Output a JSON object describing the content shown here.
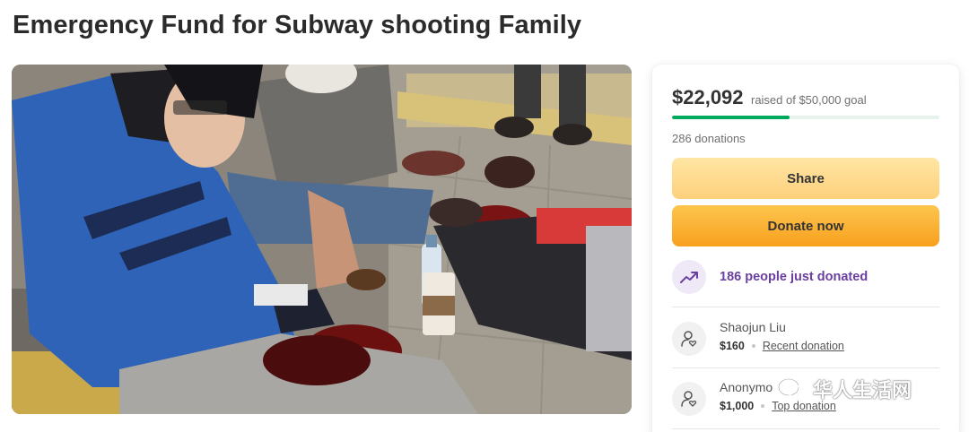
{
  "page": {
    "title": "Emergency Fund for Subway shooting Family"
  },
  "fundraiser": {
    "raised": "$22,092",
    "goal_text": "raised of $50,000 goal",
    "progress_fraction": 0.44,
    "donation_count": "286 donations",
    "share_label": "Share",
    "donate_label": "Donate now",
    "just_donated": "186 people just donated",
    "accent_color": "#02a95c",
    "trend_color": "#6b3fa0"
  },
  "donors": [
    {
      "name": "Shaojun Liu",
      "amount": "$160",
      "tag": "Recent donation",
      "icon": "donor-heart-icon"
    },
    {
      "name": "Anonymo",
      "amount": "$1,000",
      "tag": "Top donation",
      "icon": "donor-heart-icon"
    }
  ],
  "watermark": {
    "text": "华人生活网"
  }
}
